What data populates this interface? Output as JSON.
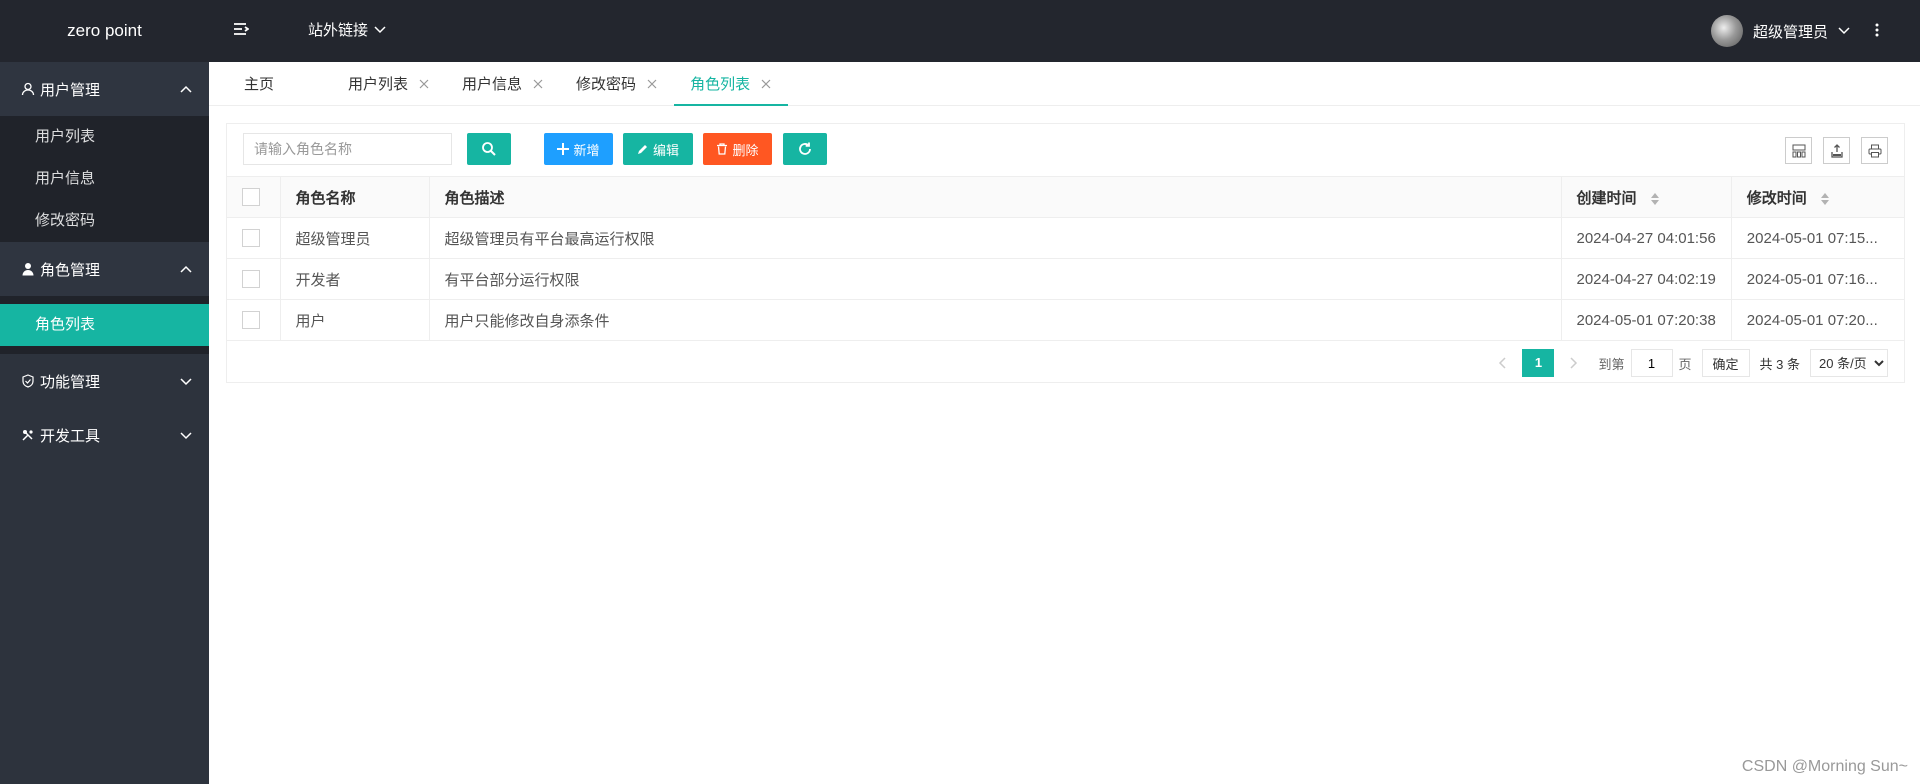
{
  "header": {
    "logo": "zero point",
    "external_links": "站外链接",
    "user_name": "超级管理员"
  },
  "sidebar": {
    "groups": [
      {
        "label": "用户管理",
        "icon": "user-icon",
        "expanded": true,
        "items": [
          "用户列表",
          "用户信息",
          "修改密码"
        ]
      },
      {
        "label": "角色管理",
        "icon": "person-icon",
        "expanded": true,
        "items": [
          "角色列表"
        ],
        "active_item": "角色列表"
      },
      {
        "label": "功能管理",
        "icon": "shield-icon",
        "expanded": false
      },
      {
        "label": "开发工具",
        "icon": "tools-icon",
        "expanded": false
      }
    ]
  },
  "tabs": [
    {
      "label": "主页",
      "closable": false
    },
    {
      "label": "用户列表",
      "closable": true
    },
    {
      "label": "用户信息",
      "closable": true
    },
    {
      "label": "修改密码",
      "closable": true
    },
    {
      "label": "角色列表",
      "closable": true,
      "active": true
    }
  ],
  "toolbar": {
    "search_placeholder": "请输入角色名称",
    "add_label": "新增",
    "edit_label": "编辑",
    "delete_label": "删除"
  },
  "table": {
    "columns": [
      "角色名称",
      "角色描述",
      "创建时间",
      "修改时间"
    ],
    "rows": [
      {
        "name": "超级管理员",
        "desc": "超级管理员有平台最高运行权限",
        "created": "2024-04-27 04:01:56",
        "modified": "2024-05-01 07:15..."
      },
      {
        "name": "开发者",
        "desc": "有平台部分运行权限",
        "created": "2024-04-27 04:02:19",
        "modified": "2024-05-01 07:16..."
      },
      {
        "name": "用户",
        "desc": "用户只能修改自身添条件",
        "created": "2024-05-01 07:20:38",
        "modified": "2024-05-01 07:20..."
      }
    ]
  },
  "pagination": {
    "current_page": "1",
    "goto_label": "到第",
    "page_input_value": "1",
    "page_suffix": "页",
    "confirm_label": "确定",
    "total_label": "共 3 条",
    "page_size_label": "20 条/页"
  },
  "watermark": "CSDN @Morning Sun~",
  "colors": {
    "header_bg": "#23262e",
    "sidebar_bg": "#2d333d",
    "accent": "#16b5a2",
    "blue": "#1e9fff",
    "danger": "#ff5722"
  }
}
